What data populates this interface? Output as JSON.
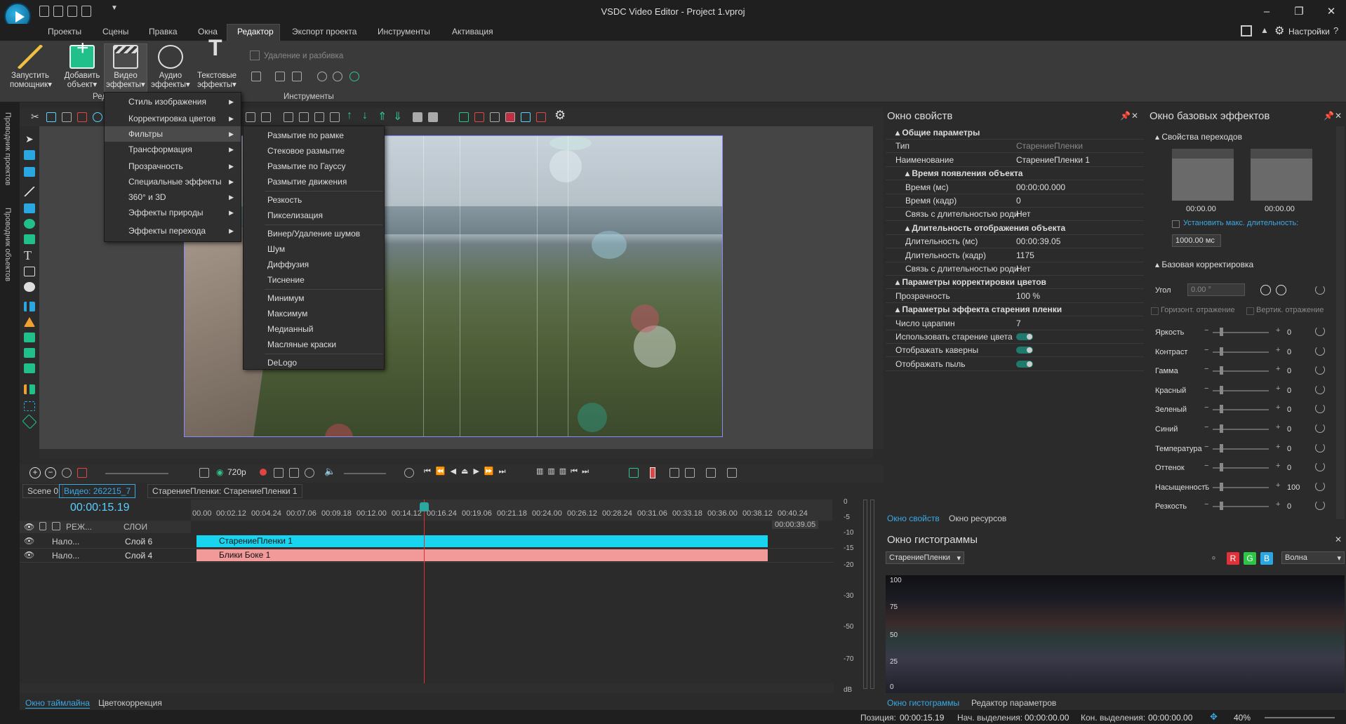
{
  "window": {
    "title": "VSDC Video Editor - Project 1.vproj"
  },
  "menubar": {
    "items": [
      "Проекты",
      "Сцены",
      "Правка",
      "Окна",
      "Редактор",
      "Экспорт проекта",
      "Инструменты",
      "Активация"
    ],
    "settings": "Настройки"
  },
  "ribbon": {
    "buttons": [
      {
        "label1": "Запустить",
        "label2": "помощник▾"
      },
      {
        "label1": "Добавить",
        "label2": "объект▾"
      },
      {
        "label1": "Видео",
        "label2": "эффекты▾"
      },
      {
        "label1": "Аудио",
        "label2": "эффекты▾"
      },
      {
        "label1": "Текстовые",
        "label2": "эффекты▾"
      }
    ],
    "group_partial": "Ред",
    "tools_group": "Инструменты",
    "delete_split": "Удаление и разбивка"
  },
  "left_dock": {
    "tab1": "Проводник проектов",
    "tab2": "Проводник объектов"
  },
  "video_effects_menu": {
    "items": [
      "Стиль изображения",
      "Корректировка цветов",
      "Фильтры",
      "Трансформация",
      "Прозрачность",
      "Специальные эффекты",
      "360° и 3D",
      "Эффекты природы",
      "Эффекты перехода"
    ],
    "active": "Фильтры"
  },
  "filters_submenu": {
    "items": [
      "Размытие по рамке",
      "Стековое размытие",
      "Размытие по Гауссу",
      "Размытие движения",
      "Резкость",
      "Пикселизация",
      "Винер/Удаление шумов",
      "Шум",
      "Диффузия",
      "Тиснение",
      "Минимум",
      "Максимум",
      "Медианный",
      "Масляные краски",
      "DeLogo"
    ]
  },
  "timeline": {
    "resolution": "720p",
    "tabs": [
      "Scene 0",
      "Видео: 262215_7",
      "СтарениеПленки: СтарениеПленки 1"
    ],
    "timecode": "00:00:15.19",
    "ruler": [
      "00.00",
      "00:02.12",
      "00:04.24",
      "00:07.06",
      "00:09.18",
      "00:12.00",
      "00:14.12",
      "00:16.24",
      "00:19.06",
      "00:21.18",
      "00:24.00",
      "00:26.12",
      "00:28.24",
      "00:31.06",
      "00:33.18",
      "00:36.00",
      "00:38.12",
      "00:40.24"
    ],
    "end_marker": "00:00:39.05",
    "header": {
      "mode": "РЕЖ...",
      "layers": "СЛОИ"
    },
    "rows": [
      {
        "blend": "Нало...",
        "layer": "Слой 6",
        "clip": "СтарениеПленки 1",
        "color": "#18d4ee"
      },
      {
        "blend": "Нало...",
        "layer": "Слой 4",
        "clip": "Блики Боке 1",
        "color": "#f29a9a"
      }
    ],
    "meter": [
      "0",
      "-5",
      "-10",
      "-15",
      "-20",
      "-30",
      "-50",
      "-70",
      "dB"
    ]
  },
  "bottom_tabs": {
    "timeline": "Окно таймлайна",
    "color": "Цветокоррекция"
  },
  "status": {
    "position_label": "Позиция:",
    "position": "00:00:15.19",
    "sel_start_label": "Нач. выделения:",
    "sel_start": "00:00:00.00",
    "sel_end_label": "Кон. выделения:",
    "sel_end": "00:00:00.00",
    "zoom": "40%"
  },
  "properties": {
    "title": "Окно свойств",
    "rows": [
      {
        "label": "Общие параметры",
        "value": "",
        "section": true
      },
      {
        "label": "Тип",
        "value": "СтарениеПленки",
        "dim": true
      },
      {
        "label": "Наименование",
        "value": "СтарениеПленки 1"
      },
      {
        "label": "Время появления объекта",
        "value": "",
        "section": true,
        "indent": true
      },
      {
        "label": "Время (мс)",
        "value": "00:00:00.000",
        "indent": true
      },
      {
        "label": "Время (кадр)",
        "value": "0",
        "indent": true
      },
      {
        "label": "Связь с длительностью роди",
        "value": "Нет",
        "indent": true
      },
      {
        "label": "Длительность отображения объекта",
        "value": "",
        "section": true,
        "indent": true
      },
      {
        "label": "Длительность (мс)",
        "value": "00:00:39.05",
        "indent": true
      },
      {
        "label": "Длительность (кадр)",
        "value": "1175",
        "indent": true
      },
      {
        "label": "Связь с длительностью роди",
        "value": "Нет",
        "indent": true
      },
      {
        "label": "Параметры корректировки цветов",
        "value": "",
        "section": true
      },
      {
        "label": "Прозрачность",
        "value": "100 %"
      },
      {
        "label": "Параметры эффекта старения пленки",
        "value": "",
        "section": true
      },
      {
        "label": "Число царапин",
        "value": "7"
      },
      {
        "label": "Использовать старение цвета",
        "value": "",
        "toggle": true
      },
      {
        "label": "Отображать каверны",
        "value": "",
        "toggle": true
      },
      {
        "label": "Отображать пыль",
        "value": "",
        "toggle": true
      }
    ],
    "tabs": [
      "Окно свойств",
      "Окно ресурсов"
    ]
  },
  "base_effects": {
    "title": "Окно базовых эффектов",
    "transitions": "Свойства переходов",
    "t1": "00:00.00",
    "t2": "00:00.00",
    "max_duration": "Установить макс. длительность:",
    "duration_value": "1000.00 мс",
    "base_correction": "Базовая корректировка",
    "angle_label": "Угол",
    "angle_value": "0.00 °",
    "hflip": "Горизонт. отражение",
    "vflip": "Вертик. отражение",
    "sliders": [
      {
        "label": "Яркость",
        "value": "0"
      },
      {
        "label": "Контраст",
        "value": "0"
      },
      {
        "label": "Гамма",
        "value": "0"
      },
      {
        "label": "Красный",
        "value": "0"
      },
      {
        "label": "Зеленый",
        "value": "0"
      },
      {
        "label": "Синий",
        "value": "0"
      },
      {
        "label": "Температура",
        "value": "0"
      },
      {
        "label": "Оттенок",
        "value": "0"
      },
      {
        "label": "Насыщенность",
        "value": "100"
      },
      {
        "label": "Резкость",
        "value": "0"
      }
    ]
  },
  "histogram": {
    "title": "Окно гистограммы",
    "source": "СтарениеПленки",
    "channels": [
      "R",
      "G",
      "B"
    ],
    "mode": "Волна",
    "scale": [
      "100",
      "75",
      "50",
      "25",
      "0"
    ],
    "tabs": [
      "Окно гистограммы",
      "Редактор параметров"
    ]
  }
}
